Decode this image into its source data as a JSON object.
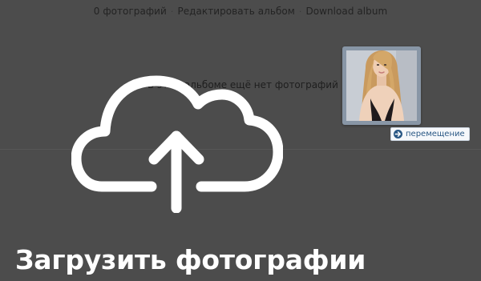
{
  "album_actions": {
    "photo_count": "0 фотографий",
    "separator": "·",
    "edit_album": "Редактировать альбом",
    "download_album": "Download album"
  },
  "empty_state": {
    "message": "В этом альбоме ещё нет фотографий"
  },
  "drag": {
    "move_label": "перемещение"
  },
  "upload": {
    "title": "Загрузить фотографии"
  },
  "icons": {
    "cloud": "cloud-upload-icon",
    "move": "arrow-right-icon"
  },
  "colors": {
    "overlay": "#4c4c4c",
    "link": "#2a5885",
    "title": "#ffffff"
  }
}
